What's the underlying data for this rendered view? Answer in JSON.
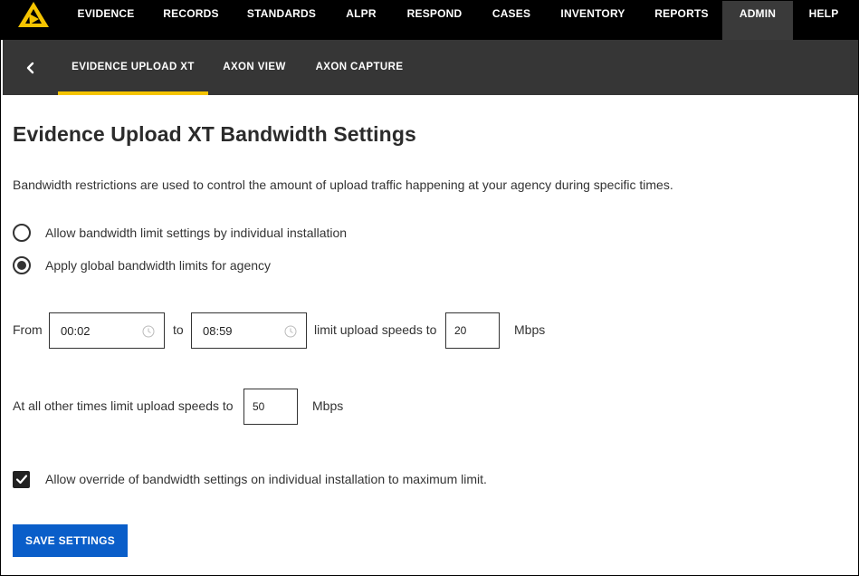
{
  "topnav": {
    "items": [
      {
        "label": "EVIDENCE"
      },
      {
        "label": "RECORDS"
      },
      {
        "label": "STANDARDS"
      },
      {
        "label": "ALPR"
      },
      {
        "label": "RESPOND"
      },
      {
        "label": "CASES"
      },
      {
        "label": "INVENTORY"
      },
      {
        "label": "REPORTS"
      },
      {
        "label": "ADMIN",
        "active": true
      },
      {
        "label": "HELP"
      }
    ],
    "logo_icon": "axon-logo-icon",
    "logo_color": "#f5c400"
  },
  "subnav": {
    "back_icon": "chevron-left-icon",
    "tabs": [
      {
        "label": "EVIDENCE UPLOAD XT",
        "active": true
      },
      {
        "label": "AXON VIEW"
      },
      {
        "label": "AXON CAPTURE"
      }
    ],
    "active_underline_color": "#f5c400"
  },
  "main": {
    "title": "Evidence Upload XT Bandwidth Settings",
    "description": "Bandwidth restrictions are used to control the amount of upload traffic happening at your agency during specific times.",
    "radio_options": [
      {
        "label": "Allow bandwidth limit settings by individual installation",
        "checked": false
      },
      {
        "label": "Apply global bandwidth limits for agency",
        "checked": true
      }
    ],
    "schedule": {
      "from_label": "From",
      "from_value": "00:02",
      "to_label": "to",
      "to_value": "08:59",
      "limit_label": "limit upload speeds to",
      "limit_value": "20",
      "unit": "Mbps"
    },
    "other_times": {
      "label": "At all other times limit upload speeds to",
      "value": "50",
      "unit": "Mbps"
    },
    "override": {
      "label": "Allow override of bandwidth settings on individual installation to maximum limit.",
      "checked": true
    },
    "save_label": "SAVE SETTINGS",
    "save_color": "#0a5ec9"
  }
}
